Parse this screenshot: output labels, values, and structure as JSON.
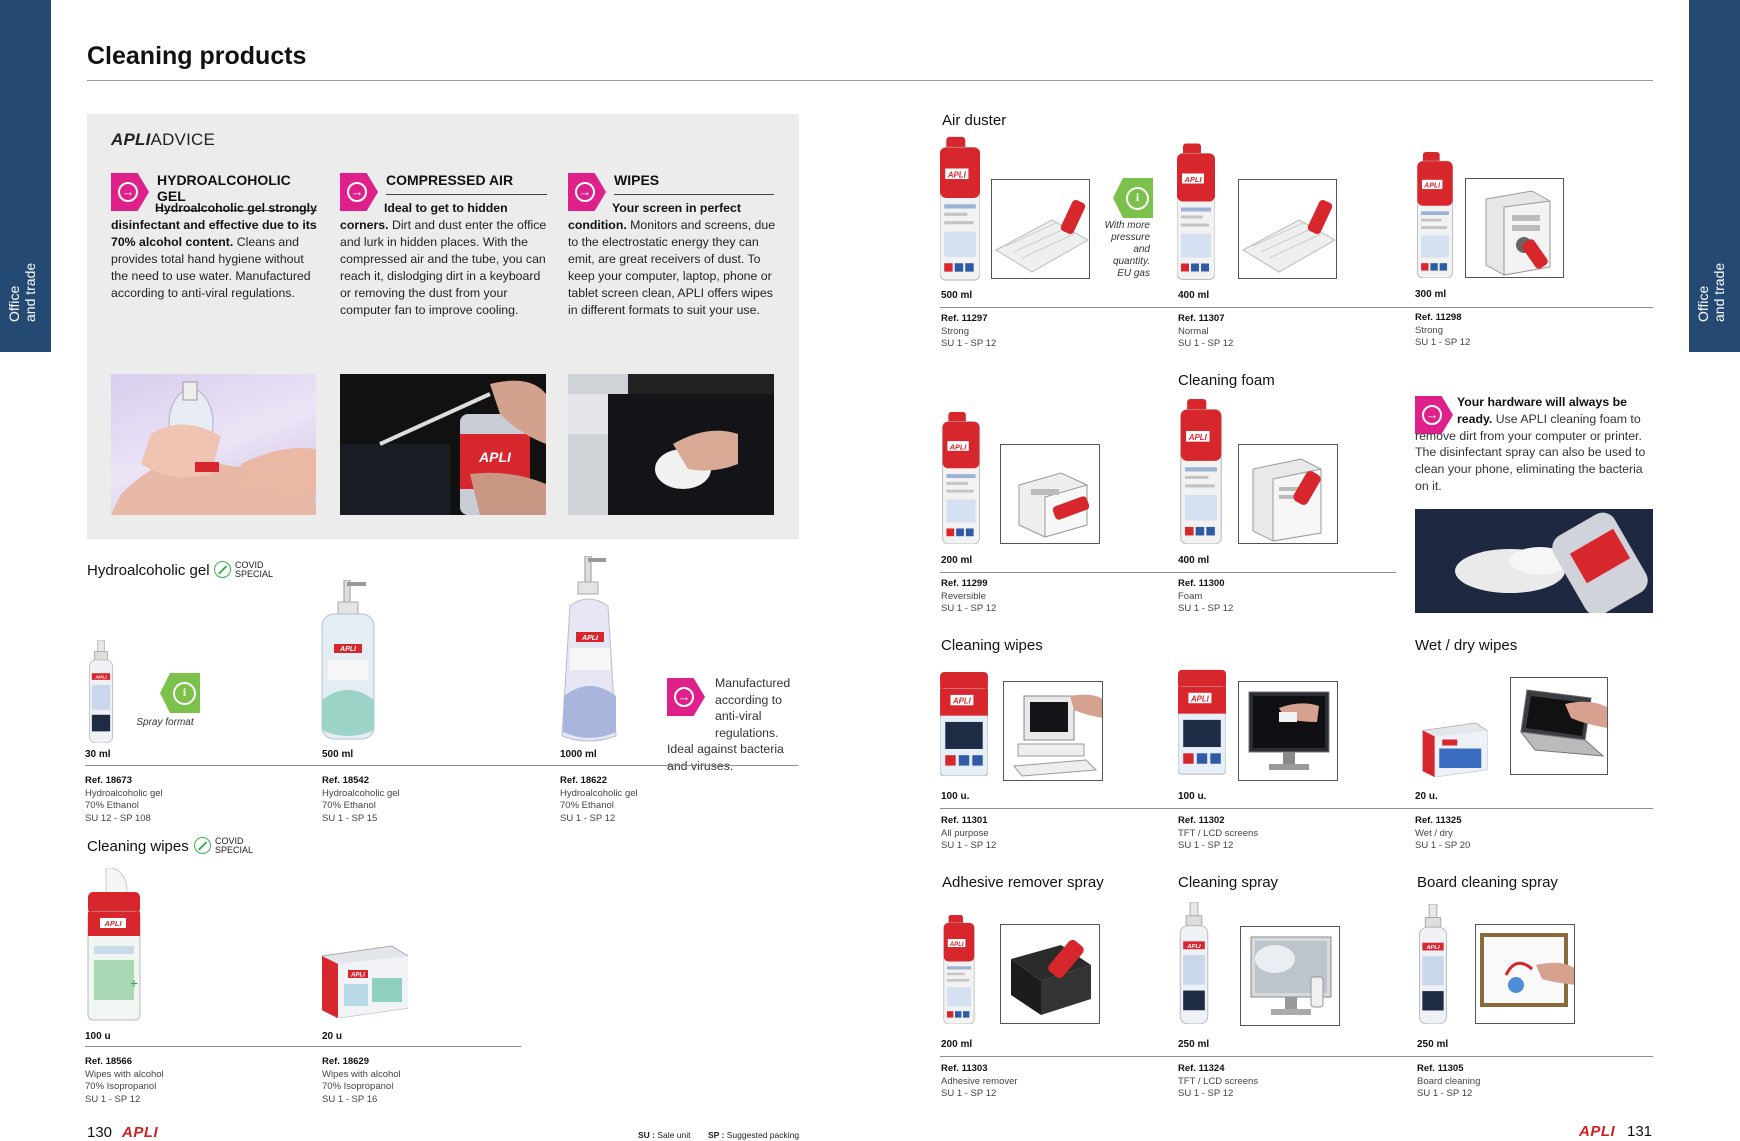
{
  "title": "Cleaning products",
  "side_tab": {
    "line1": "Office",
    "line2": "and trade"
  },
  "advice": {
    "logo_brand": "APLI",
    "logo_word": "ADVICE",
    "columns": [
      {
        "heading": "HYDROALCOHOLIC GEL",
        "bold": "Hydroalcoholic gel strongly disinfectant and effective due to its 70% alcohol content.",
        "text": " Cleans and provides total hand hygiene without the need to use water. Manufactured according to anti-viral regulations."
      },
      {
        "heading": "COMPRESSED AIR",
        "bold": "Ideal to get to hidden corners.",
        "text": " Dirt and dust enter the office and lurk in hidden places. With the compressed air and the tube, you can reach it, dislodging dirt in a keyboard or removing the dust from your computer fan to improve cooling."
      },
      {
        "heading": "WIPES",
        "bold": "Your screen in perfect condition.",
        "text": " Monitors and screens, due to the electrostatic energy they can emit, are great receivers of dust. To keep your computer, laptop, phone or tablet screen clean, APLI offers wipes in different formats to suit your use."
      }
    ]
  },
  "left": {
    "gel_section": "Hydroalcoholic gel",
    "wipes_section": "Cleaning wipes",
    "covid": [
      "COVID",
      "SPECIAL"
    ],
    "spray_format": "Spray format",
    "manufactured_note": "Manufactured according to anti-viral regulations. Ideal against bacteria and viruses.",
    "gel_products": [
      {
        "vol": "30 ml",
        "ref": "Ref. 18673",
        "l1": "Hydroalcoholic gel",
        "l2": "70% Ethanol",
        "l3": "SU 12 - SP 108"
      },
      {
        "vol": "500 ml",
        "ref": "Ref. 18542",
        "l1": "Hydroalcoholic gel",
        "l2": "70% Ethanol",
        "l3": "SU 1 - SP 15"
      },
      {
        "vol": "1000 ml",
        "ref": "Ref. 18622",
        "l1": "Hydroalcoholic gel",
        "l2": "70% Ethanol",
        "l3": "SU 1 - SP 12"
      }
    ],
    "wipe_products": [
      {
        "vol": "100 u",
        "ref": "Ref. 18566",
        "l1": "Wipes with alcohol",
        "l2": "70% Isopropanol",
        "l3": "SU 1 - SP 12"
      },
      {
        "vol": "20 u",
        "ref": "Ref. 18629",
        "l1": "Wipes with alcohol",
        "l2": "70% Isopropanol",
        "l3": "SU 1 - SP 16"
      }
    ],
    "page_number": "130",
    "su_label": "SU :",
    "su_text": "Sale unit",
    "sp_label": "SP :",
    "sp_text": "Suggested packing"
  },
  "right": {
    "air_duster": "Air duster",
    "cleaning_foam": "Cleaning foam",
    "cleaning_wipes": "Cleaning wipes",
    "wet_dry": "Wet / dry wipes",
    "adhesive": "Adhesive remover spray",
    "cleaning_spray": "Cleaning spray",
    "board_spray": "Board cleaning spray",
    "pressure_note": "With more pressure and quantity. EU gas",
    "tip_bold": "Your hardware will always be ready.",
    "tip_text": " Use APLI cleaning foam to remove dirt from your computer or printer. The disinfectant spray can also be used to clean your phone, eliminating the bacteria on it.",
    "page_number": "131",
    "products": [
      {
        "vol": "500 ml",
        "ref": "Ref. 11297",
        "l1": "Strong",
        "l2": "SU 1 - SP 12"
      },
      {
        "vol": "400 ml",
        "ref": "Ref. 11307",
        "l1": "Normal",
        "l2": "SU 1 - SP 12"
      },
      {
        "vol": "300 ml",
        "ref": "Ref. 11298",
        "l1": "Strong",
        "l2": "SU 1 - SP 12"
      },
      {
        "vol": "200 ml",
        "ref": "Ref. 11299",
        "l1": "Reversible",
        "l2": "SU 1 - SP 12"
      },
      {
        "vol": "400 ml",
        "ref": "Ref. 11300",
        "l1": "Foam",
        "l2": "SU 1 - SP 12"
      },
      {
        "vol": "100 u.",
        "ref": "Ref. 11301",
        "l1": "All purpose",
        "l2": "SU 1 - SP 12"
      },
      {
        "vol": "100 u.",
        "ref": "Ref. 11302",
        "l1": "TFT / LCD screens",
        "l2": "SU 1 - SP 12"
      },
      {
        "vol": "20 u.",
        "ref": "Ref. 11325",
        "l1": "Wet / dry",
        "l2": "SU 1 - SP 20"
      },
      {
        "vol": "200 ml",
        "ref": "Ref. 11303",
        "l1": "Adhesive remover",
        "l2": "SU 1 - SP 12"
      },
      {
        "vol": "250 ml",
        "ref": "Ref. 11324",
        "l1": "TFT / LCD screens",
        "l2": "SU 1 - SP 12"
      },
      {
        "vol": "250 ml",
        "ref": "Ref. 11305",
        "l1": "Board cleaning",
        "l2": "SU 1 - SP 12"
      }
    ]
  },
  "brand": "APLI"
}
